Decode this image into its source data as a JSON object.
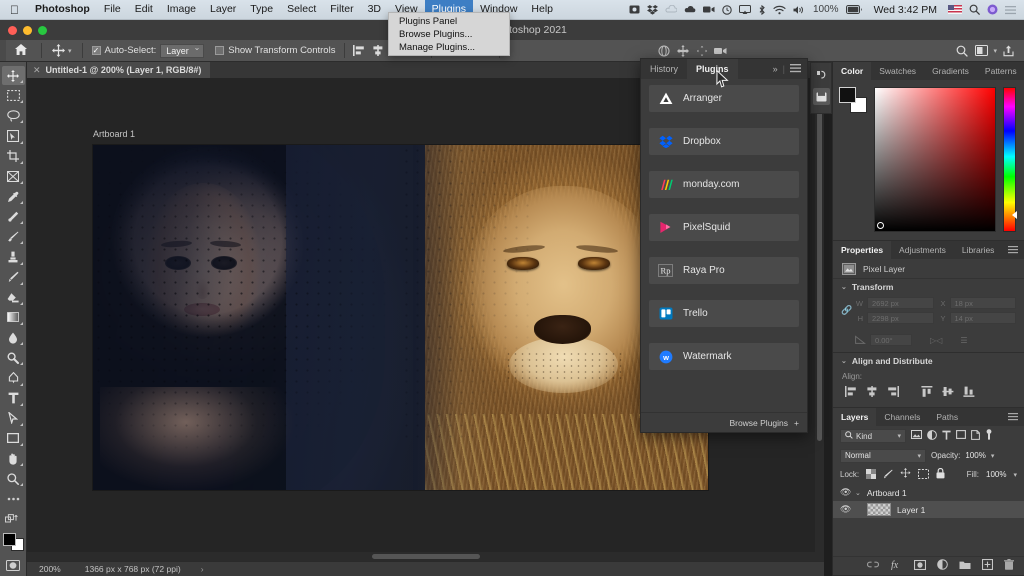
{
  "macos_menubar": {
    "apple_icon": "apple-icon",
    "app_name": "Photoshop",
    "menus": [
      "File",
      "Edit",
      "Image",
      "Layer",
      "Type",
      "Select",
      "Filter",
      "3D",
      "View",
      "Plugins",
      "Window",
      "Help"
    ],
    "active_menu": "Plugins",
    "status_icons": [
      "display-icon",
      "dropbox-icon",
      "weather-icon",
      "cloud-icon",
      "screen-record-icon",
      "clock-icon",
      "airplay-icon",
      "bluetooth-icon",
      "wifi-icon",
      "volume-icon"
    ],
    "battery_percent": "100%",
    "battery_icon": "battery-icon",
    "clock": "Wed 3:42 PM",
    "flag_icon": "us-flag-icon",
    "search_icon": "spotlight-icon",
    "siri_icon": "siri-icon",
    "control_center_icon": "control-center-icon"
  },
  "plugins_menu": {
    "items": [
      "Plugins Panel",
      "Browse Plugins...",
      "Manage Plugins..."
    ]
  },
  "window": {
    "title": "Adobe Photoshop 2021",
    "traffic_lights": [
      "close-button",
      "minimize-button",
      "zoom-button"
    ]
  },
  "options_bar": {
    "home_icon": "home-icon",
    "tool_icon": "move-tool-icon",
    "auto_select_label": "Auto-Select:",
    "auto_select_checked": true,
    "auto_select_value": "Layer",
    "show_transform_label": "Show Transform Controls",
    "show_transform_checked": false,
    "align_icons": [
      "align-left-icon",
      "align-center-h-icon",
      "align-right-icon",
      "distribute-h-icon",
      "align-top-icon",
      "align-middle-v-icon",
      "align-bottom-icon"
    ],
    "extra_icons": [
      "3d-mode-icon",
      "move-3d-icon",
      "camera-3d-icon"
    ],
    "right_icons": [
      "search-icon",
      "workspace-icon",
      "chevron-down-icon",
      "share-icon"
    ]
  },
  "document_tab": {
    "close_icon": "close-icon",
    "label": "Untitled-1 @ 200% (Layer 1, RGB/8#)"
  },
  "toolbar": {
    "tools": [
      {
        "name": "move-tool",
        "glyph": "move"
      },
      {
        "name": "rectangular-marquee-tool",
        "glyph": "marquee"
      },
      {
        "name": "lasso-tool",
        "glyph": "lasso"
      },
      {
        "name": "object-selection-tool",
        "glyph": "objsel"
      },
      {
        "name": "crop-tool",
        "glyph": "crop"
      },
      {
        "name": "frame-tool",
        "glyph": "frame"
      },
      {
        "name": "eyedropper-tool",
        "glyph": "eyedropper"
      },
      {
        "name": "spot-healing-brush-tool",
        "glyph": "healing"
      },
      {
        "name": "brush-tool",
        "glyph": "brush"
      },
      {
        "name": "clone-stamp-tool",
        "glyph": "stamp"
      },
      {
        "name": "history-brush-tool",
        "glyph": "historybrush"
      },
      {
        "name": "eraser-tool",
        "glyph": "eraser"
      },
      {
        "name": "gradient-tool",
        "glyph": "gradient"
      },
      {
        "name": "blur-tool",
        "glyph": "blur"
      },
      {
        "name": "dodge-tool",
        "glyph": "dodge"
      },
      {
        "name": "pen-tool",
        "glyph": "pen"
      },
      {
        "name": "type-tool",
        "glyph": "type"
      },
      {
        "name": "path-selection-tool",
        "glyph": "pathsel"
      },
      {
        "name": "rectangle-tool",
        "glyph": "rect"
      },
      {
        "name": "hand-tool",
        "glyph": "hand"
      },
      {
        "name": "zoom-tool",
        "glyph": "zoom"
      },
      {
        "name": "edit-toolbar",
        "glyph": "dots"
      },
      {
        "name": "default-colors",
        "glyph": "swapcolors"
      }
    ],
    "selected_tool": "move-tool",
    "foreground_color": "#000000",
    "background_color": "#ffffff",
    "quick_mask_icon": "quick-mask-icon"
  },
  "canvas": {
    "artboard_label": "Artboard 1",
    "artwork_description": "Composite of a woman wearing a dark polka-dot veil blended with a lion's face"
  },
  "status_bar": {
    "zoom_level": "200%",
    "document_dimensions": "1366 px x 768 px (72 ppi)",
    "expander_icon": "chevron-right-icon"
  },
  "plugins_panel": {
    "tabs": [
      {
        "label": "History",
        "active": false
      },
      {
        "label": "Plugins",
        "active": true
      }
    ],
    "collapse_icon": "double-chevron-right-icon",
    "menu_icon": "panel-menu-icon",
    "items": [
      {
        "label": "Arranger",
        "icon": "arranger-icon",
        "color": "#ffffff"
      },
      {
        "label": "Dropbox",
        "icon": "dropbox-icon",
        "color": "#0061ff"
      },
      {
        "label": "monday.com",
        "icon": "monday-icon",
        "color": "#ff3d57"
      },
      {
        "label": "PixelSquid",
        "icon": "pixelsquid-icon",
        "color": "#e6266d"
      },
      {
        "label": "Raya Pro",
        "icon": "rayapro-icon",
        "color": "#d8d8d8"
      },
      {
        "label": "Trello",
        "icon": "trello-icon",
        "color": "#0079bf"
      },
      {
        "label": "Watermark",
        "icon": "watermark-icon",
        "color": "#1f7bff"
      }
    ],
    "footer_label": "Browse Plugins",
    "footer_icon": "plus-icon"
  },
  "mini_dock": {
    "icons": [
      "history-brush-icon",
      "notes-icon"
    ]
  },
  "color_panel": {
    "tabs": [
      {
        "label": "Color",
        "active": true
      },
      {
        "label": "Swatches",
        "active": false
      },
      {
        "label": "Gradients",
        "active": false
      },
      {
        "label": "Patterns",
        "active": false
      }
    ],
    "menu_icon": "panel-menu-icon",
    "foreground_color": "#111111",
    "background_color": "#ffffff",
    "ramp_hue": "#ff0000"
  },
  "properties_panel": {
    "tabs": [
      {
        "label": "Properties",
        "active": true
      },
      {
        "label": "Adjustments",
        "active": false
      },
      {
        "label": "Libraries",
        "active": false
      }
    ],
    "menu_icon": "panel-menu-icon",
    "layer_type_label": "Pixel Layer",
    "layer_type_icon": "pixel-layer-icon",
    "transform_section": "Transform",
    "fields": {
      "w_label": "W",
      "w_value": "2692 px",
      "h_label": "H",
      "h_value": "2298 px",
      "x_label": "X",
      "x_value": "18 px",
      "y_label": "Y",
      "y_value": "14 px",
      "angle_value": "0.00°"
    },
    "link_icon": "link-icon",
    "flip_h_icon": "flip-horizontal-icon",
    "flip_v_icon": "flip-vertical-icon",
    "align_section": "Align and Distribute",
    "align_label": "Align:",
    "align_icons": [
      "align-left-icon",
      "align-center-h-icon",
      "align-right-icon",
      "align-top-icon",
      "align-middle-v-icon",
      "align-bottom-icon"
    ]
  },
  "layers_panel": {
    "tabs": [
      {
        "label": "Layers",
        "active": true
      },
      {
        "label": "Channels",
        "active": false
      },
      {
        "label": "Paths",
        "active": false
      }
    ],
    "menu_icon": "panel-menu-icon",
    "filter_label": "Kind",
    "filter_icon": "search-icon",
    "filter_type_icons": [
      "pixel-filter-icon",
      "adjustment-filter-icon",
      "type-filter-icon",
      "shape-filter-icon",
      "smart-object-filter-icon",
      "toggle-filter-icon"
    ],
    "blend_mode": "Normal",
    "opacity_label": "Opacity:",
    "opacity_value": "100%",
    "lock_label": "Lock:",
    "lock_icons": [
      "lock-transparency-icon",
      "lock-image-icon",
      "lock-position-icon",
      "lock-artboard-icon",
      "lock-all-icon"
    ],
    "fill_label": "Fill:",
    "fill_value": "100%",
    "rows": [
      {
        "name": "Artboard 1",
        "type": "artboard",
        "visible": true,
        "expanded": true
      },
      {
        "name": "Layer 1",
        "type": "pixel",
        "visible": true,
        "selected": true
      }
    ],
    "footer_icons": [
      "link-layers-icon",
      "layer-style-icon",
      "layer-mask-icon",
      "adjustment-layer-icon",
      "new-group-icon",
      "new-layer-icon",
      "delete-layer-icon"
    ]
  }
}
